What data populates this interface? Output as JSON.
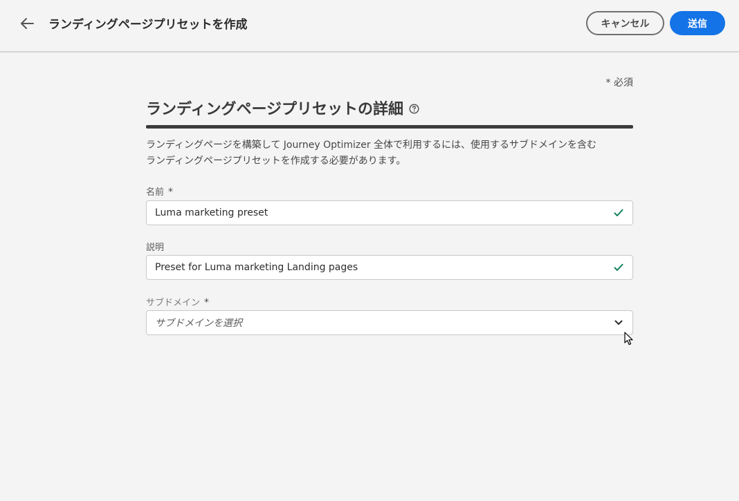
{
  "header": {
    "title": "ランディングページプリセットを作成",
    "cancel_label": "キャンセル",
    "submit_label": "送信"
  },
  "form": {
    "required_note": "* 必須",
    "section_title": "ランディングページプリセットの詳細",
    "description_line1": "ランディングページを構築して Journey Optimizer 全体で利用するには、使用するサブドメインを含む",
    "description_line2": "ランディングページプリセットを作成する必要があります。",
    "name": {
      "label": "名前",
      "required_marker": "*",
      "value": "Luma marketing preset"
    },
    "description_field": {
      "label": "説明",
      "value": "Preset for Luma marketing Landing pages"
    },
    "subdomain": {
      "label": "サブドメイン",
      "required_marker": "*",
      "placeholder": "サブドメインを選択"
    }
  },
  "colors": {
    "accent": "#1473e6",
    "valid": "#12805c",
    "background": "#f4f4f4"
  },
  "icons": {
    "back": "arrow-left-icon",
    "help": "help-circle-icon",
    "valid": "checkmark-icon",
    "dropdown": "chevron-down-icon"
  }
}
